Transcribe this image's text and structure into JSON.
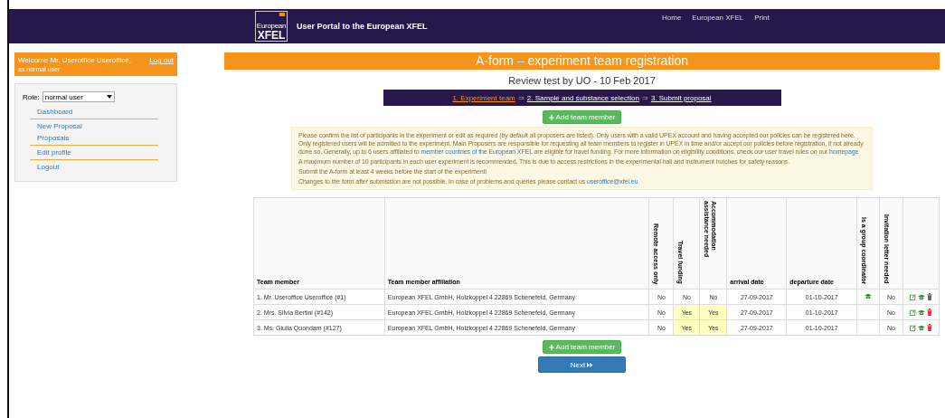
{
  "header": {
    "logo_top": "European",
    "logo_main": "XFEL",
    "title": "User Portal to the European XFEL",
    "nav": [
      "Home",
      "European XFEL",
      "Print"
    ]
  },
  "sidebar": {
    "welcome": "Welcome Mr. Useroffice Useroffice,",
    "role_note": "as normal user",
    "logout_link": "Log out",
    "role_label": "Role:",
    "role_value": "normal user",
    "groups": [
      [
        "Dashboard"
      ],
      [
        "New Proposal",
        "Proposals"
      ],
      [
        "Edit profile"
      ],
      [
        "Logout"
      ]
    ]
  },
  "main": {
    "title": "A-form – experiment team registration",
    "subtitle": "Review test by UO - 10 Feb 2017",
    "steps": [
      {
        "label": "1. Experiment team",
        "selected": true
      },
      {
        "label": "2. Sample and substance selection",
        "selected": false
      },
      {
        "label": "3. Submit proposal",
        "selected": false
      }
    ],
    "step_separator": "⇒",
    "add_button": "Add team member",
    "notice": [
      [
        {
          "text": "Please confirm the list of participants in the experiment or edit as required (by default all proposers are listed). Only users with a valid UPEX account and having accepted our policies can be registered here. Only registered users will be admitted to the experiment. Main Proposers are responsible for requesting all team members to register in UPEX in time and/or accept our policies before registration, if not already done so. Generally, up to 6 users affiliated to ",
          "link": false
        },
        {
          "text": "member countries of the European XFEL",
          "link": true
        },
        {
          "text": " are eligible for travel funding. For more information on eligibility conditions, check our user travel rules on our ",
          "link": false
        },
        {
          "text": "homepage",
          "link": true
        }
      ],
      [
        {
          "text": "A maximum number of 10 participants in each user experiment is recommended. This is due to access restrictions in the experimental hall and instrument hutches for safety reasons.",
          "link": false
        }
      ],
      [
        {
          "text": "Submit the A-form at least 4 weeks before the start of the experiment!",
          "link": false
        }
      ],
      [
        {
          "text": "Changes to the form after submission are not possible. In case of problems and queries please contact us ",
          "link": false
        },
        {
          "text": "useroffice@xfel.eu",
          "link": true
        }
      ]
    ],
    "table": {
      "columns": [
        {
          "label": "Team member",
          "kind": "text"
        },
        {
          "label": "Team member affiliation",
          "kind": "text"
        },
        {
          "label": "Remote access only",
          "kind": "vertical"
        },
        {
          "label": "Travel funding",
          "kind": "vertical"
        },
        {
          "label": "Accommodation assistance needed",
          "kind": "vertical"
        },
        {
          "label": "arrival date",
          "kind": "text"
        },
        {
          "label": "departure date",
          "kind": "text"
        },
        {
          "label": "Is a group coordinator",
          "kind": "vertical"
        },
        {
          "label": "Invitation letter needed",
          "kind": "vertical"
        }
      ],
      "rows": [
        {
          "name": "1. Mr. Useroffice Useroffice",
          "id": "(#1)",
          "affiliation": "European XFEL GmbH, Holzkoppel 4 22869 Schenefeld, Germany",
          "remote": {
            "text": "No",
            "highlighted": false
          },
          "travel": {
            "text": "No",
            "highlighted": false
          },
          "accommodation": {
            "text": "No",
            "highlighted": false
          },
          "arrival": "27-09-2017",
          "departure": "01-10-2017",
          "coordinator": true,
          "invitation": "No",
          "deletable": false
        },
        {
          "name": "2. Mrs. Silvia Bertini",
          "id": "(#142)",
          "affiliation": "European XFEL GmbH, Holzkoppel 4 22869 Schenefeld, Germany",
          "remote": {
            "text": "No",
            "highlighted": false
          },
          "travel": {
            "text": "Yes",
            "highlighted": true
          },
          "accommodation": {
            "text": "Yes",
            "highlighted": true
          },
          "arrival": "27-09-2017",
          "departure": "01-10-2017",
          "coordinator": false,
          "invitation": "No",
          "deletable": true
        },
        {
          "name": "3. Ms. Giulia Quondam",
          "id": "(#127)",
          "affiliation": "European XFEL GmbH, Holzkoppel 4 22869 Schenefeld, Germany",
          "remote": {
            "text": "No",
            "highlighted": false
          },
          "travel": {
            "text": "Yes",
            "highlighted": true
          },
          "accommodation": {
            "text": "Yes",
            "highlighted": true
          },
          "arrival": "27-09-2017",
          "departure": "01-10-2017",
          "coordinator": false,
          "invitation": "No",
          "deletable": true
        }
      ]
    },
    "add_button_bottom": "Add team member",
    "next_button": "Next"
  }
}
